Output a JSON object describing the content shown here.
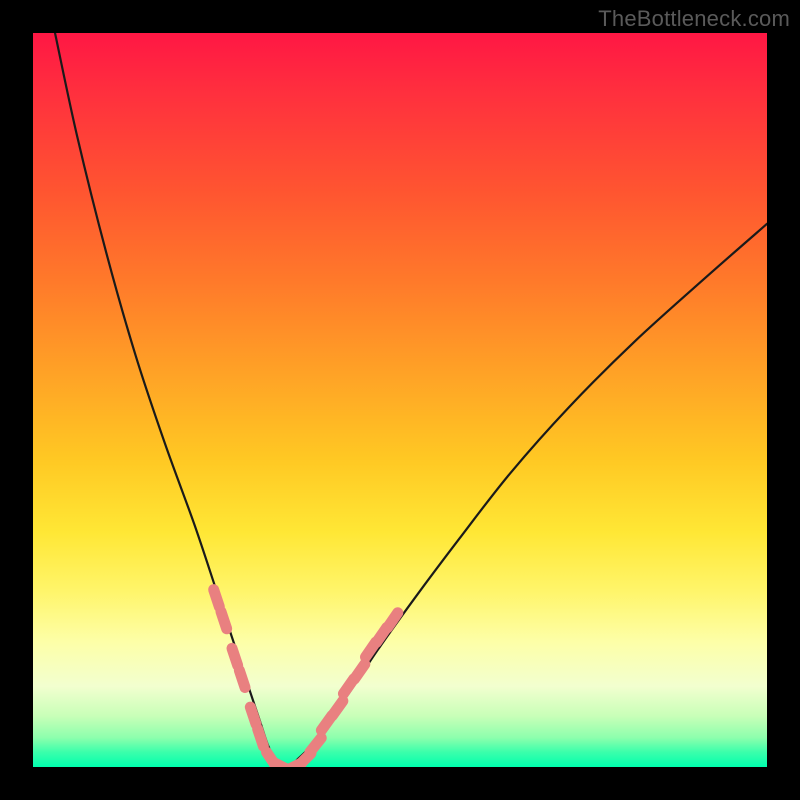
{
  "watermark": "TheBottleneck.com",
  "colors": {
    "background": "#000000",
    "curve": "#1a1a1a",
    "markers": "#e98080",
    "gradient_top": "#ff1744",
    "gradient_bottom": "#00ffae"
  },
  "chart_data": {
    "type": "line",
    "title": "",
    "xlabel": "",
    "ylabel": "",
    "xlim": [
      0,
      100
    ],
    "ylim": [
      0,
      100
    ],
    "grid": false,
    "legend": false,
    "description": "V-shaped bottleneck curve on a red-to-green vertical gradient background. Values are bottleneck-percentage-style readings (0 = green/good at the notch, 100 = red/bad at the top).",
    "series": [
      {
        "name": "curve",
        "x": [
          3,
          6,
          10,
          14,
          18,
          22,
          25,
          27,
          29,
          31,
          32,
          33,
          34,
          35,
          36,
          38,
          40,
          43,
          47,
          52,
          58,
          65,
          73,
          82,
          92,
          100
        ],
        "y": [
          100,
          86,
          70,
          56,
          44,
          33,
          24,
          18,
          12,
          6,
          3,
          1,
          0,
          0,
          1,
          3,
          6,
          10,
          16,
          23,
          31,
          40,
          49,
          58,
          67,
          74
        ]
      }
    ],
    "markers": {
      "description": "Short salmon dash markers laid along the lower part of the V, roughly where the curve is in the 0–20% band.",
      "points": [
        {
          "x": 25.0,
          "y": 23
        },
        {
          "x": 26.0,
          "y": 20
        },
        {
          "x": 27.5,
          "y": 15
        },
        {
          "x": 28.5,
          "y": 12
        },
        {
          "x": 30.0,
          "y": 7
        },
        {
          "x": 31.0,
          "y": 4
        },
        {
          "x": 32.5,
          "y": 1
        },
        {
          "x": 34.0,
          "y": 0
        },
        {
          "x": 35.5,
          "y": 0
        },
        {
          "x": 37.0,
          "y": 1
        },
        {
          "x": 38.5,
          "y": 3
        },
        {
          "x": 40.0,
          "y": 6
        },
        {
          "x": 41.5,
          "y": 8
        },
        {
          "x": 43.0,
          "y": 11
        },
        {
          "x": 44.5,
          "y": 13
        },
        {
          "x": 46.0,
          "y": 16
        },
        {
          "x": 47.5,
          "y": 18
        },
        {
          "x": 49.0,
          "y": 20
        }
      ]
    }
  }
}
